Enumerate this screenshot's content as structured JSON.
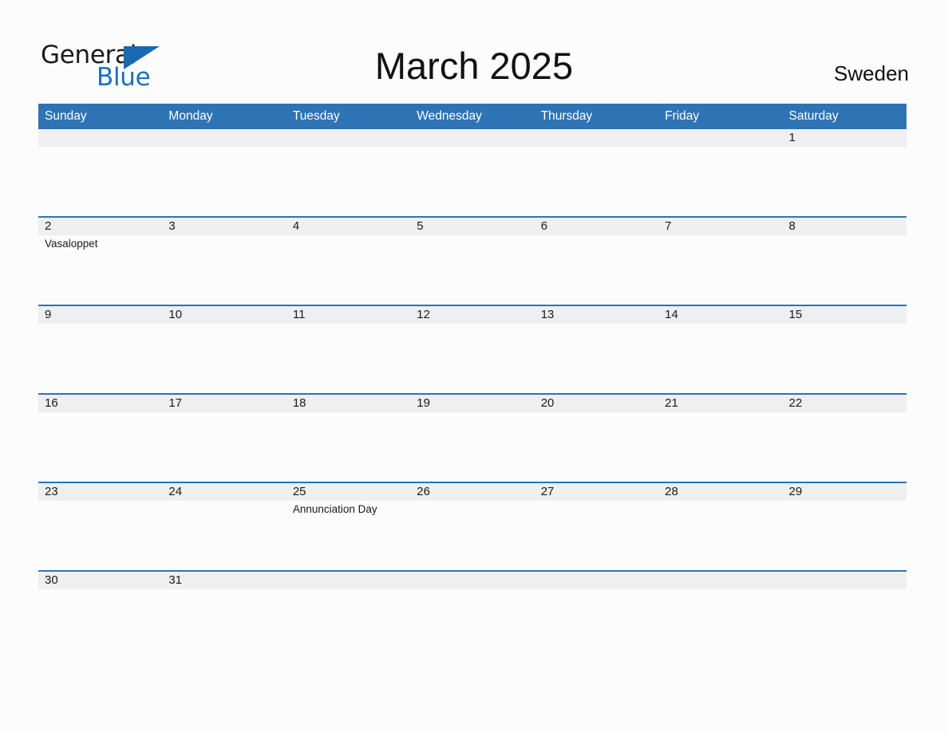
{
  "brand": {
    "name_part1": "General",
    "name_part2": "Blue",
    "triangle_color": "#1769b0",
    "text_color_blue": "#1a72bb"
  },
  "header": {
    "title": "March 2025",
    "country": "Sweden"
  },
  "theme": {
    "header_blue": "#2e73b4",
    "date_band_gray": "#efefef",
    "page_background": "#fcfcfc",
    "text_color": "#1a1a1a"
  },
  "calendar": {
    "month": "March",
    "year": "2025",
    "weekday_headers": [
      "Sunday",
      "Monday",
      "Tuesday",
      "Wednesday",
      "Thursday",
      "Friday",
      "Saturday"
    ],
    "weeks": [
      [
        {
          "day": "",
          "events": []
        },
        {
          "day": "",
          "events": []
        },
        {
          "day": "",
          "events": []
        },
        {
          "day": "",
          "events": []
        },
        {
          "day": "",
          "events": []
        },
        {
          "day": "",
          "events": []
        },
        {
          "day": "1",
          "events": []
        }
      ],
      [
        {
          "day": "2",
          "events": [
            "Vasaloppet"
          ]
        },
        {
          "day": "3",
          "events": []
        },
        {
          "day": "4",
          "events": []
        },
        {
          "day": "5",
          "events": []
        },
        {
          "day": "6",
          "events": []
        },
        {
          "day": "7",
          "events": []
        },
        {
          "day": "8",
          "events": []
        }
      ],
      [
        {
          "day": "9",
          "events": []
        },
        {
          "day": "10",
          "events": []
        },
        {
          "day": "11",
          "events": []
        },
        {
          "day": "12",
          "events": []
        },
        {
          "day": "13",
          "events": []
        },
        {
          "day": "14",
          "events": []
        },
        {
          "day": "15",
          "events": []
        }
      ],
      [
        {
          "day": "16",
          "events": []
        },
        {
          "day": "17",
          "events": []
        },
        {
          "day": "18",
          "events": []
        },
        {
          "day": "19",
          "events": []
        },
        {
          "day": "20",
          "events": []
        },
        {
          "day": "21",
          "events": []
        },
        {
          "day": "22",
          "events": []
        }
      ],
      [
        {
          "day": "23",
          "events": []
        },
        {
          "day": "24",
          "events": []
        },
        {
          "day": "25",
          "events": [
            "Annunciation Day"
          ]
        },
        {
          "day": "26",
          "events": []
        },
        {
          "day": "27",
          "events": []
        },
        {
          "day": "28",
          "events": []
        },
        {
          "day": "29",
          "events": []
        }
      ],
      [
        {
          "day": "30",
          "events": []
        },
        {
          "day": "31",
          "events": []
        },
        {
          "day": "",
          "events": []
        },
        {
          "day": "",
          "events": []
        },
        {
          "day": "",
          "events": []
        },
        {
          "day": "",
          "events": []
        },
        {
          "day": "",
          "events": []
        }
      ]
    ]
  }
}
